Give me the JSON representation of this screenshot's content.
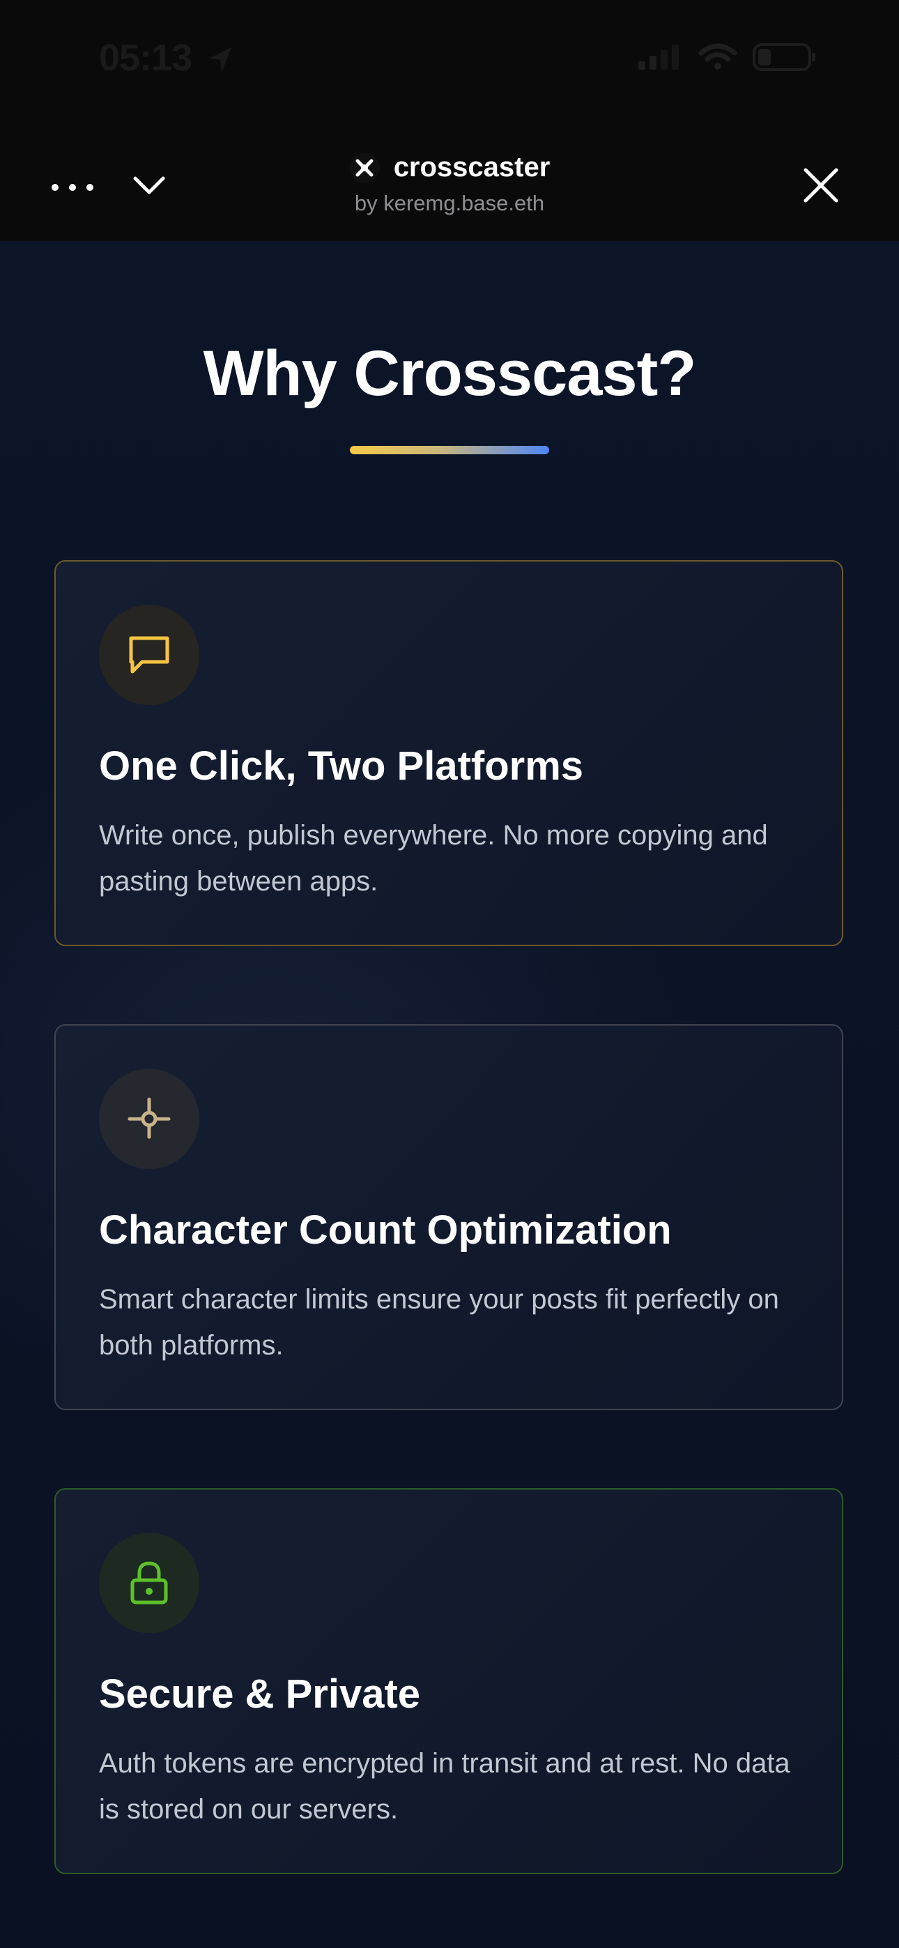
{
  "status_bar": {
    "time": "05:13"
  },
  "app_header": {
    "name": "crosscaster",
    "author": "by keremg.base.eth"
  },
  "main": {
    "title": "Why Crosscast?"
  },
  "features": [
    {
      "title": "One Click, Two Platforms",
      "description": "Write once, publish everywhere. No more copying and pasting between apps.",
      "icon": "chat-bubble-icon",
      "accent": "#f5c542"
    },
    {
      "title": "Character Count Optimization",
      "description": "Smart character limits ensure your posts fit perfectly on both platforms.",
      "icon": "crosshair-icon",
      "accent": "#c8b48a"
    },
    {
      "title": "Secure & Private",
      "description": "Auth tokens are encrypted in transit and at rest. No data is stored on our servers.",
      "icon": "lock-icon",
      "accent": "#5ec12a"
    }
  ],
  "colors": {
    "underline_gradient": [
      "#f7c948",
      "#4f86f7"
    ],
    "background": "#0b1120"
  }
}
